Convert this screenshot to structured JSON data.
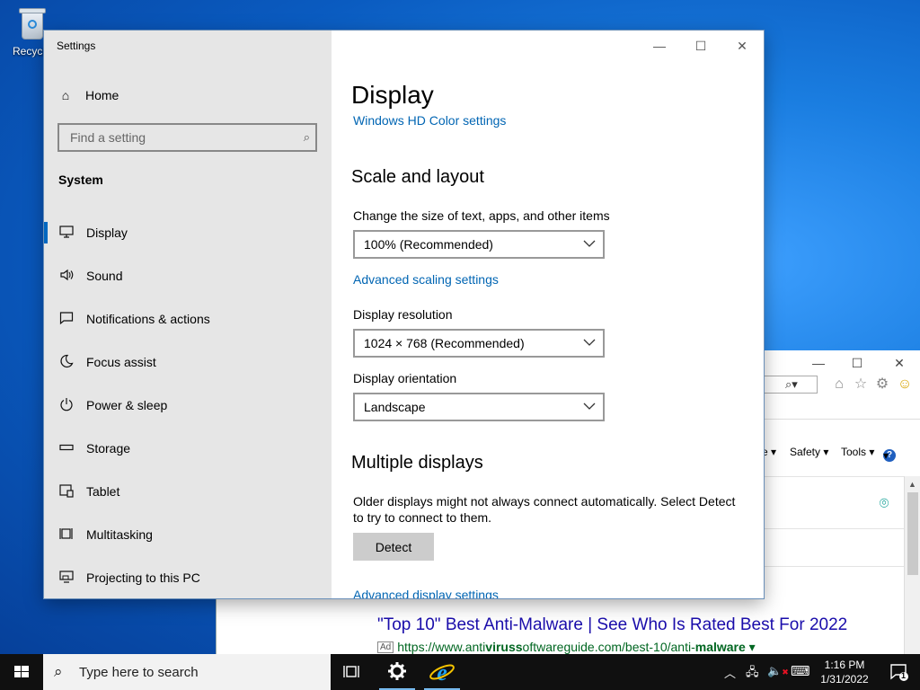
{
  "desktop": {
    "recycle_bin_label": "Recycle Bin"
  },
  "ie": {
    "command_bar": {
      "page_fragment": "e ▾",
      "safety": "Safety ▾",
      "tools": "Tools ▾",
      "help": "▾"
    },
    "ad": {
      "title": "\"Top 10\" Best Anti-Malware | See Who Is Rated Best For 2022",
      "badge": "Ad",
      "url_prefix": "https://www.anti",
      "url_bold1": "viruss",
      "url_mid": "oftwareguide.com/best-10/anti-",
      "url_bold2": "malware",
      "url_suffix": " ▾"
    }
  },
  "settings": {
    "window_title": "Settings",
    "nav": {
      "home": "Home",
      "search_placeholder": "Find a setting",
      "group": "System",
      "items": [
        {
          "label": "Display",
          "icon": "monitor-icon",
          "active": true
        },
        {
          "label": "Sound",
          "icon": "speaker-icon",
          "active": false
        },
        {
          "label": "Notifications & actions",
          "icon": "notification-icon",
          "active": false
        },
        {
          "label": "Focus assist",
          "icon": "moon-icon",
          "active": false
        },
        {
          "label": "Power & sleep",
          "icon": "power-icon",
          "active": false
        },
        {
          "label": "Storage",
          "icon": "storage-icon",
          "active": false
        },
        {
          "label": "Tablet",
          "icon": "tablet-icon",
          "active": false
        },
        {
          "label": "Multitasking",
          "icon": "multitasking-icon",
          "active": false
        },
        {
          "label": "Projecting to this PC",
          "icon": "projecting-icon",
          "active": false
        }
      ]
    },
    "content": {
      "title": "Display",
      "hd_color_link": "Windows HD Color settings",
      "scale_heading": "Scale and layout",
      "scale_label": "Change the size of text, apps, and other items",
      "scale_value": "100% (Recommended)",
      "advanced_scaling_link": "Advanced scaling settings",
      "resolution_label": "Display resolution",
      "resolution_value": "1024 × 768 (Recommended)",
      "orientation_label": "Display orientation",
      "orientation_value": "Landscape",
      "multiple_heading": "Multiple displays",
      "multiple_desc": "Older displays might not always connect automatically. Select Detect to try to connect to them.",
      "detect_button": "Detect",
      "advanced_display_link": "Advanced display settings"
    }
  },
  "taskbar": {
    "search_text": "Type here to search",
    "time": "1:16 PM",
    "date": "1/31/2022",
    "notification_count": "1"
  },
  "colors": {
    "accent": "#0067c0",
    "link": "#0065b3",
    "nav_bg": "#e6e6e6",
    "taskbar": "#101010"
  }
}
